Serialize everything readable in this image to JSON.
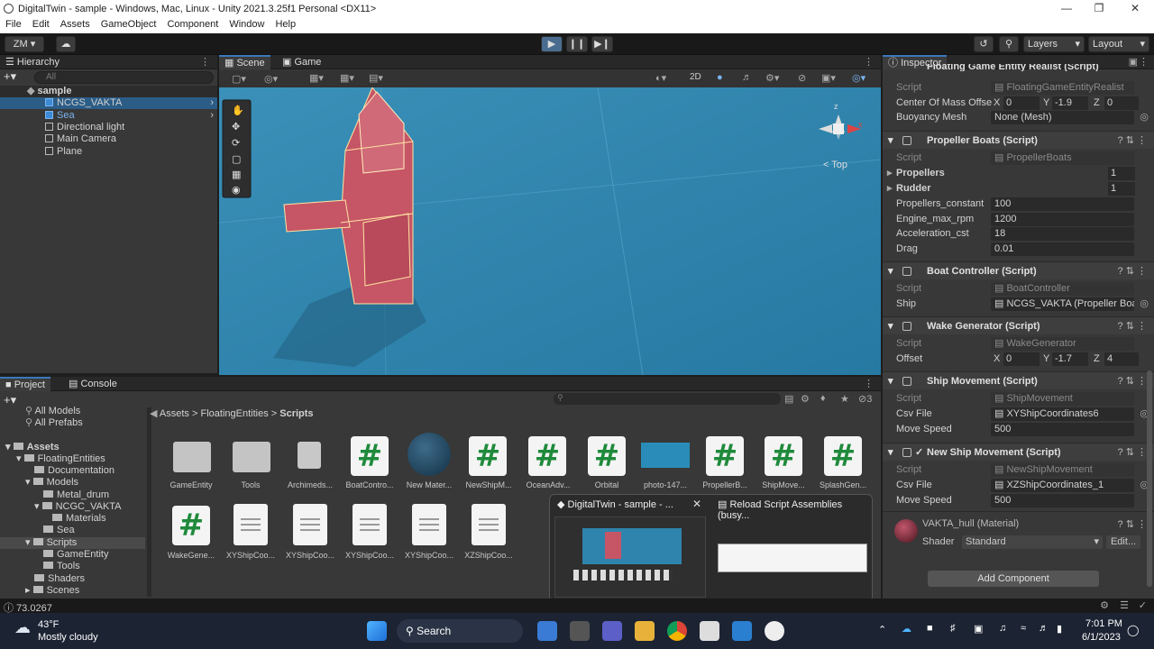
{
  "window": {
    "title": "DigitalTwin - sample - Windows, Mac, Linux - Unity 2021.3.25f1 Personal <DX11>"
  },
  "menu": [
    "File",
    "Edit",
    "Assets",
    "GameObject",
    "Component",
    "Window",
    "Help"
  ],
  "toolbar": {
    "account": "ZM",
    "layers": "Layers",
    "layout": "Layout"
  },
  "hierarchy": {
    "tab": "Hierarchy",
    "search_placeholder": "All",
    "items": [
      "sample",
      "NCGS_VAKTA",
      "Sea",
      "Directional light",
      "Main Camera",
      "Plane"
    ]
  },
  "scene": {
    "tabs": [
      "Scene",
      "Game"
    ],
    "mode2d": "2D",
    "gizmo_label": "Top"
  },
  "project": {
    "tabs": [
      "Project",
      "Console"
    ],
    "hidden_count": "3",
    "breadcrumb": [
      "Assets",
      "FloatingEntities",
      "Scripts"
    ],
    "favorites": [
      "All Models",
      "All Prefabs"
    ],
    "tree": [
      "Assets",
      "FloatingEntities",
      "Documentation",
      "Models",
      "Metal_drum",
      "NCGC_VAKTA",
      "Materials",
      "Sea",
      "Scripts",
      "GameEntity",
      "Tools",
      "Shaders",
      "Scenes"
    ],
    "grid_row1": [
      "GameEntity",
      "Tools",
      "Archimeds...",
      "BoatContro...",
      "New Mater...",
      "NewShipM...",
      "OceanAdv...",
      "Orbital",
      "photo-147...",
      "PropellerB...",
      "ShipMove...",
      "SplashGen..."
    ],
    "grid_row2": [
      "WakeGene...",
      "XYShipCoo...",
      "XYShipCoo...",
      "XYShipCoo...",
      "XYShipCoo...",
      "XZShipCoo..."
    ]
  },
  "inspector": {
    "tab": "Inspector",
    "floating": {
      "title": "Floating Game Entity Realist (Script)",
      "script": "FloatingGameEntityRealist",
      "com_label": "Center Of Mass Offse",
      "com": {
        "x": "0",
        "y": "-1.9",
        "z": "0"
      },
      "buoy_label": "Buoyancy Mesh",
      "buoy": "None (Mesh)"
    },
    "propeller": {
      "title": "Propeller Boats (Script)",
      "script": "PropellerBoats",
      "propellers_label": "Propellers",
      "propellers": "1",
      "rudder_label": "Rudder",
      "rudder": "1",
      "pc_label": "Propellers_constant",
      "pc": "100",
      "emr_label": "Engine_max_rpm",
      "emr": "1200",
      "acc_label": "Acceleration_cst",
      "acc": "18",
      "drag_label": "Drag",
      "drag": "0.01"
    },
    "boat": {
      "title": "Boat Controller (Script)",
      "script": "BoatController",
      "ship_label": "Ship",
      "ship": "NCGS_VAKTA (Propeller Boat"
    },
    "wake": {
      "title": "Wake Generator (Script)",
      "script": "WakeGenerator",
      "offset_label": "Offset",
      "offset": {
        "x": "0",
        "y": "-1.7",
        "z": "4"
      }
    },
    "shipmove": {
      "title": "Ship Movement (Script)",
      "script": "ShipMovement",
      "csv_label": "Csv File",
      "csv": "XYShipCoordinates6",
      "speed_label": "Move Speed",
      "speed": "500"
    },
    "newship": {
      "title": "New Ship Movement (Script)",
      "script": "NewShipMovement",
      "csv_label": "Csv File",
      "csv": "XZShipCoordinates_1",
      "speed_label": "Move Speed",
      "speed": "500"
    },
    "material": {
      "name": "VAKTA_hull (Material)",
      "shader_label": "Shader",
      "shader": "Standard",
      "edit": "Edit..."
    },
    "script_label": "Script",
    "add_component": "Add Component"
  },
  "status": {
    "fps": "73.0267"
  },
  "popup": {
    "title": "DigitalTwin - sample - ...",
    "reload": "Reload Script Assemblies (busy..."
  },
  "taskbar": {
    "weather_temp": "43°F",
    "weather_desc": "Mostly cloudy",
    "search": "Search",
    "time": "7:01 PM",
    "date": "6/1/2023"
  }
}
